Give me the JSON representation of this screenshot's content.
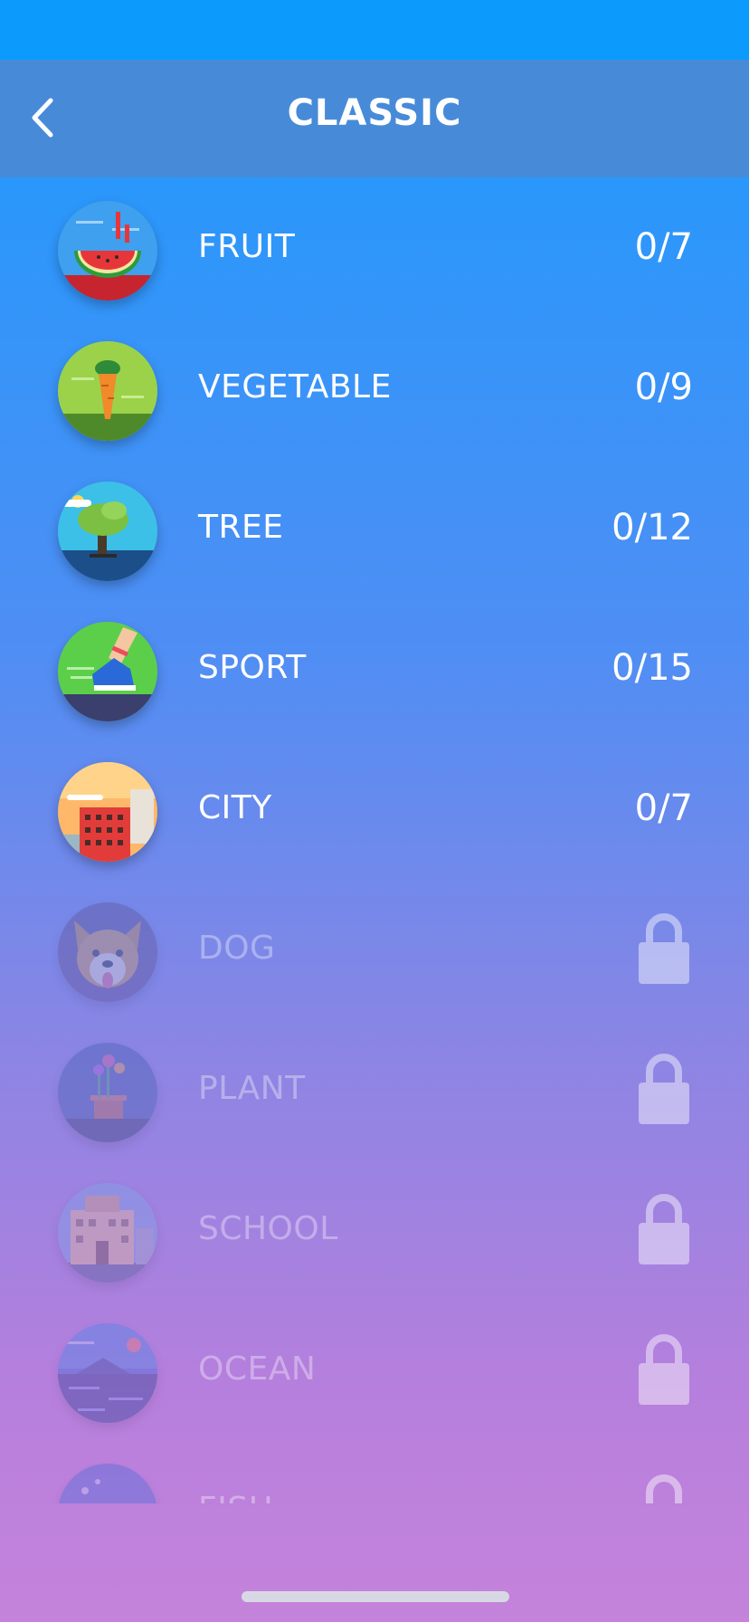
{
  "header": {
    "title": "CLASSIC",
    "back_icon": "chevron-left-icon"
  },
  "categories": [
    {
      "name": "FRUIT",
      "progress": "0/7",
      "locked": false,
      "icon": "watermelon-icon"
    },
    {
      "name": "VEGETABLE",
      "progress": "0/9",
      "locked": false,
      "icon": "carrot-icon"
    },
    {
      "name": "TREE",
      "progress": "0/12",
      "locked": false,
      "icon": "tree-icon"
    },
    {
      "name": "SPORT",
      "progress": "0/15",
      "locked": false,
      "icon": "sneaker-icon"
    },
    {
      "name": "CITY",
      "progress": "0/7",
      "locked": false,
      "icon": "building-icon"
    },
    {
      "name": "DOG",
      "locked": true,
      "icon": "dog-icon"
    },
    {
      "name": "PLANT",
      "locked": true,
      "icon": "potted-plant-icon"
    },
    {
      "name": "SCHOOL",
      "locked": true,
      "icon": "school-icon"
    },
    {
      "name": "OCEAN",
      "locked": true,
      "icon": "ocean-icon"
    },
    {
      "name": "FISH",
      "locked": true,
      "icon": "fish-icon"
    }
  ],
  "colors": {
    "status_bar": "#0c9bfd",
    "nav_bar": "#478bd8",
    "gradient_top": "#1a9bfc",
    "gradient_bottom": "#c583db",
    "text": "#ffffff"
  }
}
